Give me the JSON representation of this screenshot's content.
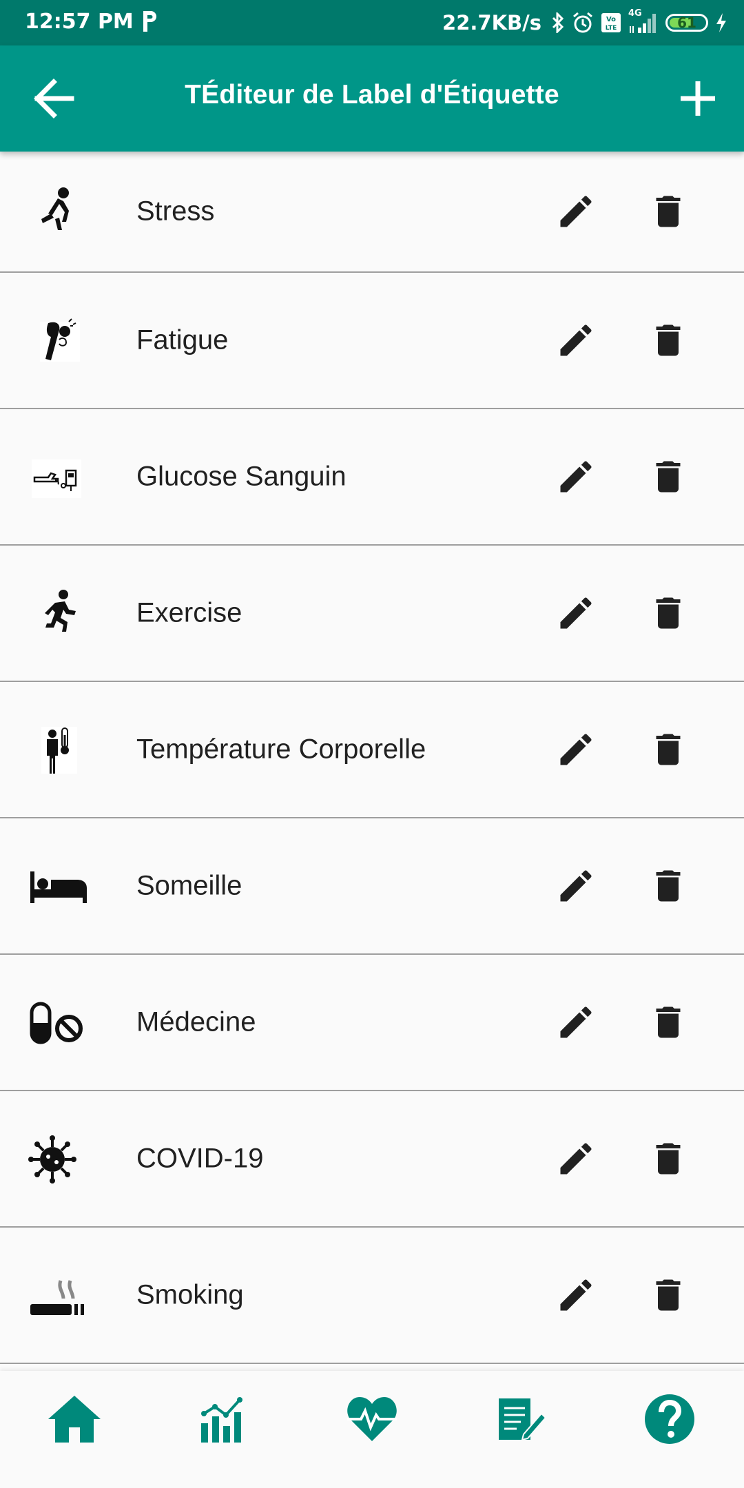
{
  "status_bar": {
    "time": "12:57 PM",
    "speed": "22.7KB/s",
    "network": "4G",
    "battery": "61"
  },
  "app_bar": {
    "title": "TÉditeur de Label d'Étiquette"
  },
  "labels": [
    {
      "label": "Stress",
      "icon": "stressed-person-icon"
    },
    {
      "label": "Fatigue",
      "icon": "tired-person-icon"
    },
    {
      "label": "Glucose Sanguin",
      "icon": "glucose-meter-icon"
    },
    {
      "label": "Exercise",
      "icon": "running-person-icon"
    },
    {
      "label": "Température Corporelle",
      "icon": "person-thermometer-icon"
    },
    {
      "label": "Someille",
      "icon": "bed-icon"
    },
    {
      "label": "Médecine",
      "icon": "pill-no-icon"
    },
    {
      "label": "COVID-19",
      "icon": "virus-icon"
    },
    {
      "label": "Smoking",
      "icon": "cigarette-icon"
    }
  ],
  "colors": {
    "app_bar": "#009688",
    "status_bar": "#00796b",
    "nav_icons": "#00897b"
  },
  "bottom_nav": [
    "home-icon",
    "chart-icon",
    "heart-pulse-icon",
    "notes-icon",
    "help-icon"
  ]
}
